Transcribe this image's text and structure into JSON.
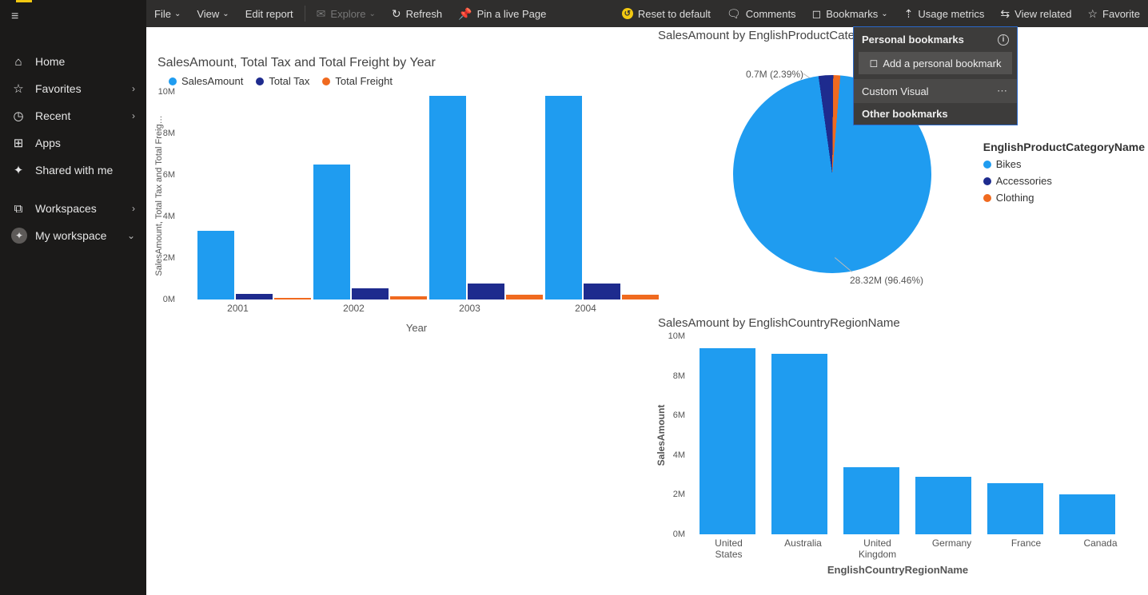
{
  "sidebar": {
    "items": [
      {
        "label": "Home",
        "icon": "home"
      },
      {
        "label": "Favorites",
        "icon": "star",
        "chevron": true
      },
      {
        "label": "Recent",
        "icon": "clock",
        "chevron": true
      },
      {
        "label": "Apps",
        "icon": "apps"
      },
      {
        "label": "Shared with me",
        "icon": "share"
      }
    ],
    "workspaces_label": "Workspaces",
    "myworkspace_label": "My workspace"
  },
  "toolbar": {
    "file": "File",
    "view": "View",
    "edit_report": "Edit report",
    "explore": "Explore",
    "refresh": "Refresh",
    "pin": "Pin a live Page",
    "reset": "Reset to default",
    "comments": "Comments",
    "bookmarks": "Bookmarks",
    "usage": "Usage metrics",
    "related": "View related",
    "favorite": "Favorite"
  },
  "bookmarks_menu": {
    "header": "Personal bookmarks",
    "add": "Add a personal bookmark",
    "custom": "Custom Visual",
    "other": "Other bookmarks"
  },
  "chart1": {
    "title": "SalesAmount, Total Tax and Total Freight by Year",
    "legend": [
      "SalesAmount",
      "Total Tax",
      "Total Freight"
    ],
    "ylabel": "SalesAmount, Total Tax and Total Freig…",
    "xlabel": "Year",
    "yticks": [
      "0M",
      "2M",
      "4M",
      "6M",
      "8M",
      "10M"
    ]
  },
  "chart2": {
    "title": "SalesAmount by EnglishProductCategoryName",
    "legend_title": "EnglishProductCategoryName",
    "legend": [
      "Bikes",
      "Accessories",
      "Clothing"
    ],
    "label_small": "0.7M (2.39%)",
    "label_big": "28.32M (96.46%)"
  },
  "chart3": {
    "title": "SalesAmount by EnglishCountryRegionName",
    "ylabel": "SalesAmount",
    "xlabel": "EnglishCountryRegionName",
    "yticks": [
      "0M",
      "2M",
      "4M",
      "6M",
      "8M",
      "10M"
    ]
  },
  "chart_data": [
    {
      "type": "bar",
      "title": "SalesAmount, Total Tax and Total Freight by Year",
      "xlabel": "Year",
      "ylabel": "SalesAmount, Total Tax and Total Freight",
      "ylim": [
        0,
        10000000
      ],
      "categories": [
        "2001",
        "2002",
        "2003",
        "2004"
      ],
      "series": [
        {
          "name": "SalesAmount",
          "values": [
            3300000,
            6500000,
            9800000,
            9800000
          ]
        },
        {
          "name": "Total Tax",
          "values": [
            260000,
            520000,
            780000,
            780000
          ]
        },
        {
          "name": "Total Freight",
          "values": [
            80000,
            160000,
            240000,
            240000
          ]
        }
      ]
    },
    {
      "type": "pie",
      "title": "SalesAmount by EnglishProductCategoryName",
      "series": [
        {
          "name": "Bikes",
          "value": 28320000,
          "pct": 96.46
        },
        {
          "name": "Accessories",
          "value": 700000,
          "pct": 2.39
        },
        {
          "name": "Clothing",
          "value": 340000,
          "pct": 1.15
        }
      ]
    },
    {
      "type": "bar",
      "title": "SalesAmount by EnglishCountryRegionName",
      "xlabel": "EnglishCountryRegionName",
      "ylabel": "SalesAmount",
      "ylim": [
        0,
        10000000
      ],
      "categories": [
        "United States",
        "Australia",
        "United Kingdom",
        "Germany",
        "France",
        "Canada"
      ],
      "values": [
        9400000,
        9100000,
        3400000,
        2900000,
        2600000,
        2000000
      ]
    }
  ]
}
